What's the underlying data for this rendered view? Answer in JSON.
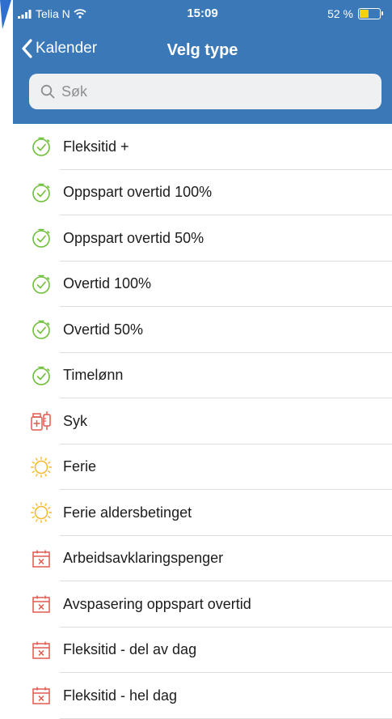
{
  "status_bar": {
    "carrier": "Telia N",
    "time": "15:09",
    "battery": "52 %",
    "battery_level": 0.52
  },
  "nav": {
    "back_label": "Kalender",
    "title": "Velg type"
  },
  "search": {
    "placeholder": "Søk"
  },
  "colors": {
    "header": "#3a78b8",
    "clock_icon": "#6fbf3a",
    "sun_icon": "#f5b82e",
    "calendar_icon": "#e05a50",
    "sick_icon": "#e05a50"
  },
  "items": [
    {
      "label": "Fleksitid +",
      "icon": "stopwatch-icon"
    },
    {
      "label": "Oppspart overtid 100%",
      "icon": "stopwatch-icon"
    },
    {
      "label": "Oppspart overtid 50%",
      "icon": "stopwatch-icon"
    },
    {
      "label": "Overtid 100%",
      "icon": "stopwatch-icon"
    },
    {
      "label": "Overtid 50%",
      "icon": "stopwatch-icon"
    },
    {
      "label": "Timelønn",
      "icon": "stopwatch-icon"
    },
    {
      "label": "Syk",
      "icon": "medicine-icon"
    },
    {
      "label": "Ferie",
      "icon": "sun-icon"
    },
    {
      "label": "Ferie aldersbetinget",
      "icon": "sun-icon"
    },
    {
      "label": "Arbeidsavklaringspenger",
      "icon": "calendar-x-icon"
    },
    {
      "label": "Avspasering oppspart overtid",
      "icon": "calendar-x-icon"
    },
    {
      "label": "Fleksitid - del av dag",
      "icon": "calendar-x-icon"
    },
    {
      "label": "Fleksitid - hel dag",
      "icon": "calendar-x-icon"
    }
  ]
}
